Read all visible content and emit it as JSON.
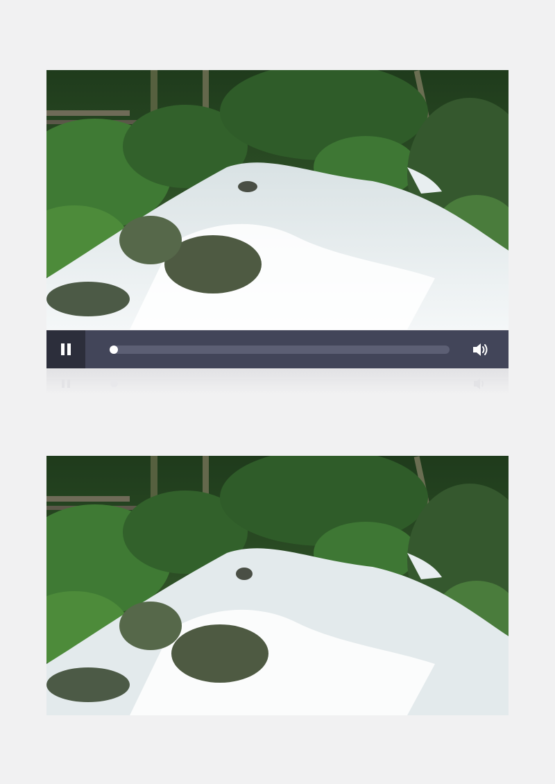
{
  "player": {
    "state": "playing",
    "progress": 0.0,
    "controls": {
      "play_pause_icon": "pause-icon",
      "volume_icon": "speaker-volume-icon"
    },
    "colors": {
      "control_bar": "#424559",
      "play_button_bg": "#2c2e3b",
      "track": "#5c5f74",
      "thumb": "#ffffff"
    }
  },
  "scene": {
    "subject": "forest-stream-rapids"
  }
}
